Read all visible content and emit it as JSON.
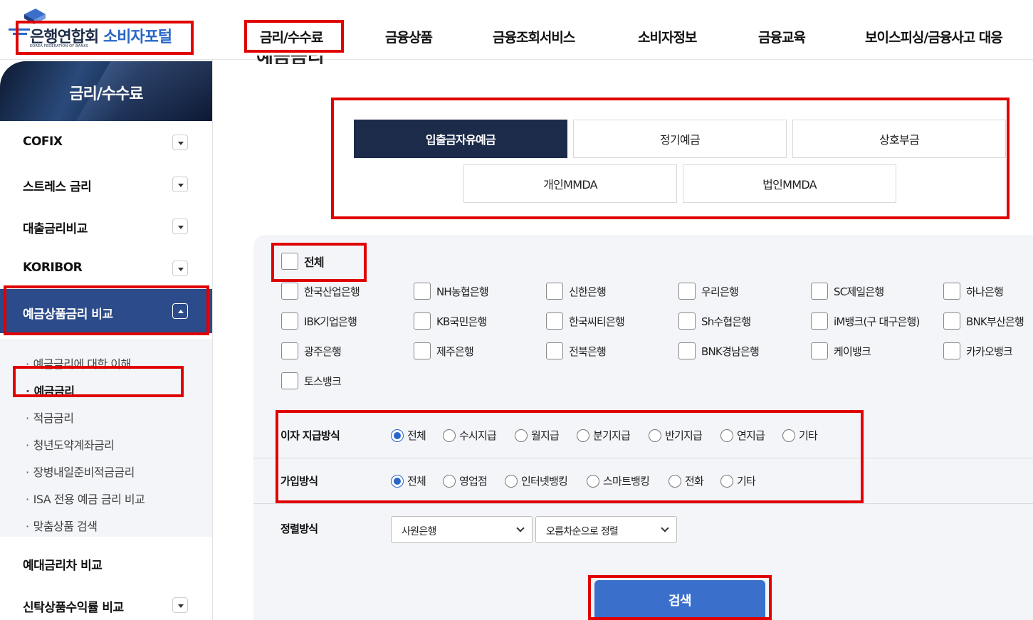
{
  "header": {
    "logo_text": "은행연합회",
    "logo_portal": "소비자포털",
    "logo_sub": "KOREA FEDERATION OF BANKS",
    "nav": [
      "금리/수수료",
      "금융상품",
      "금융조회서비스",
      "소비자정보",
      "금융교육",
      "보이스피싱/금융사고 대응"
    ]
  },
  "sidebar": {
    "title": "금리/수수료",
    "items": [
      {
        "label": "COFIX"
      },
      {
        "label": "스트레스 금리"
      },
      {
        "label": "대출금리비교"
      },
      {
        "label": "KORIBOR"
      },
      {
        "label": "예금상품금리 비교"
      }
    ],
    "sub_items": [
      "예금금리에 대한 이해",
      "예금금리",
      "적금금리",
      "청년도약계좌금리",
      "장병내일준비적금금리",
      "ISA 전용 예금 금리 비교",
      "맞춤상품 검색"
    ],
    "bottom_items": [
      {
        "label": "예대금리차 비교"
      },
      {
        "label": "신탁상품수익률 비교"
      }
    ]
  },
  "main": {
    "partial_heading": "예금금리",
    "tabs_row1": [
      "입출금자유예금",
      "정기예금",
      "상호부금"
    ],
    "tabs_row2": [
      "개인MMDA",
      "법인MMDA"
    ],
    "all_label": "전체",
    "banks": [
      "한국산업은행",
      "NH농협은행",
      "신한은행",
      "우리은행",
      "SC제일은행",
      "하나은행",
      "IBK기업은행",
      "KB국민은행",
      "한국씨티은행",
      "Sh수협은행",
      "iM뱅크(구 대구은행)",
      "BNK부산은행",
      "광주은행",
      "제주은행",
      "전북은행",
      "BNK경남은행",
      "케이뱅크",
      "카카오뱅크",
      "토스뱅크"
    ],
    "interest_label": "이자 지급방식",
    "interest_options": [
      "전체",
      "수시지급",
      "월지급",
      "분기지급",
      "반기지급",
      "연지급",
      "기타"
    ],
    "join_label": "가입방식",
    "join_options": [
      "전체",
      "영업점",
      "인터넷뱅킹",
      "스마트뱅킹",
      "전화",
      "기타"
    ],
    "sort_label": "정렬방식",
    "sort_select1": "사원은행",
    "sort_select2": "오름차순으로 정렬",
    "search_label": "검색"
  },
  "colors": {
    "brand_navy": "#1c2b4a",
    "sidebar_active": "#2c4b8a",
    "accent_blue": "#3a6fcb",
    "highlight_red": "#e00000"
  }
}
